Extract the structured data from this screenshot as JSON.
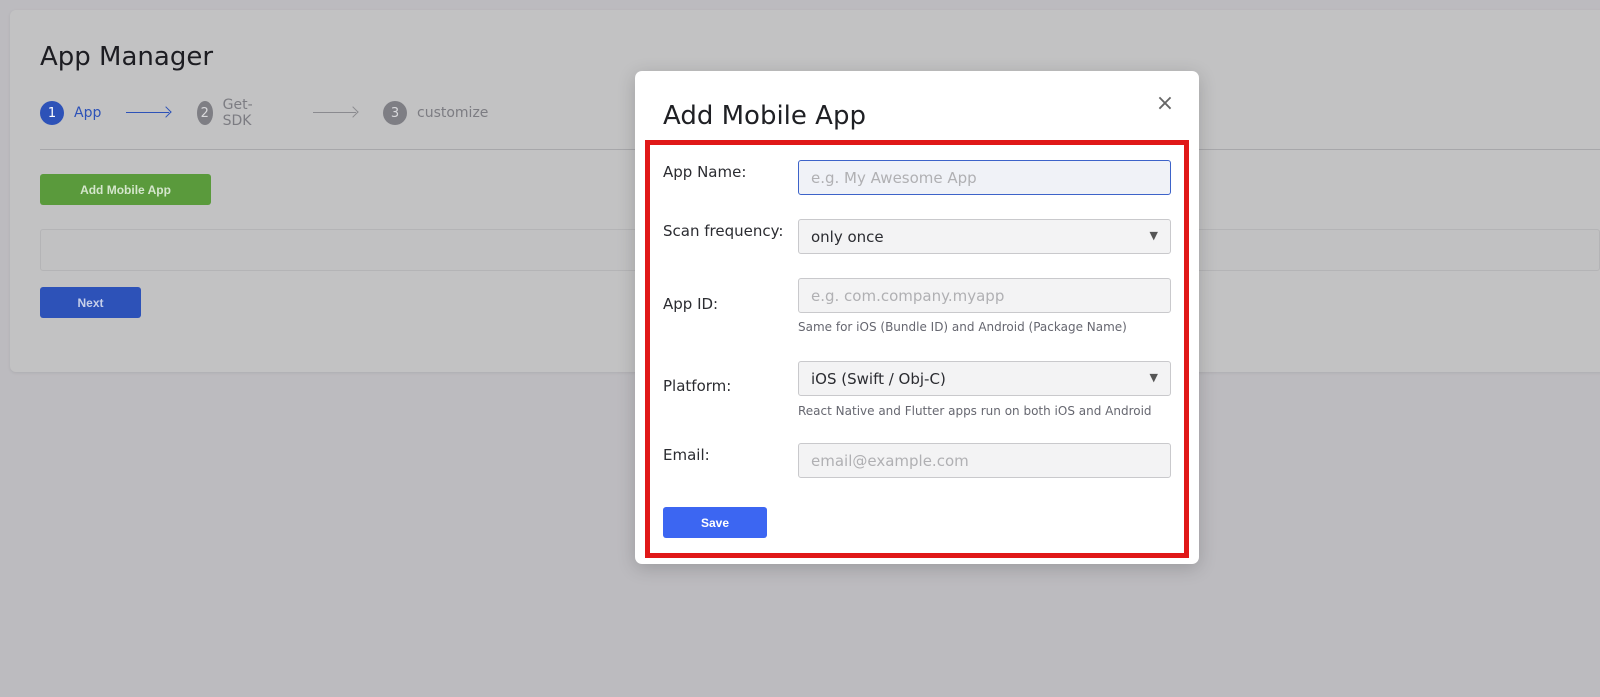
{
  "page": {
    "title": "App Manager",
    "steps": [
      {
        "number": "1",
        "label": "App",
        "state": "active"
      },
      {
        "number": "2",
        "label": "Get-SDK",
        "state": "inactive"
      },
      {
        "number": "3",
        "label": "customize",
        "state": "inactive"
      }
    ],
    "add_button_label": "Add Mobile App",
    "next_button_label": "Next"
  },
  "modal": {
    "title": "Add Mobile App",
    "close_icon": "×",
    "fields": {
      "app_name": {
        "label": "App Name:",
        "placeholder": "e.g. My Awesome App",
        "value": ""
      },
      "scan_frequency": {
        "label": "Scan frequency:",
        "selected": "only once"
      },
      "app_id": {
        "label": "App ID:",
        "placeholder": "e.g. com.company.myapp",
        "value": "",
        "hint": "Same for iOS (Bundle ID) and Android (Package Name)"
      },
      "platform": {
        "label": "Platform:",
        "selected": "iOS (Swift / Obj-C)",
        "hint": "React Native and Flutter apps run on both iOS and Android"
      },
      "email": {
        "label": "Email:",
        "placeholder": "email@example.com",
        "value": ""
      }
    },
    "save_label": "Save"
  },
  "colors": {
    "accent": "#2d52b8",
    "save_button": "#3c66f2",
    "add_button": "#5a9a3c",
    "highlight_border": "#e01818"
  }
}
